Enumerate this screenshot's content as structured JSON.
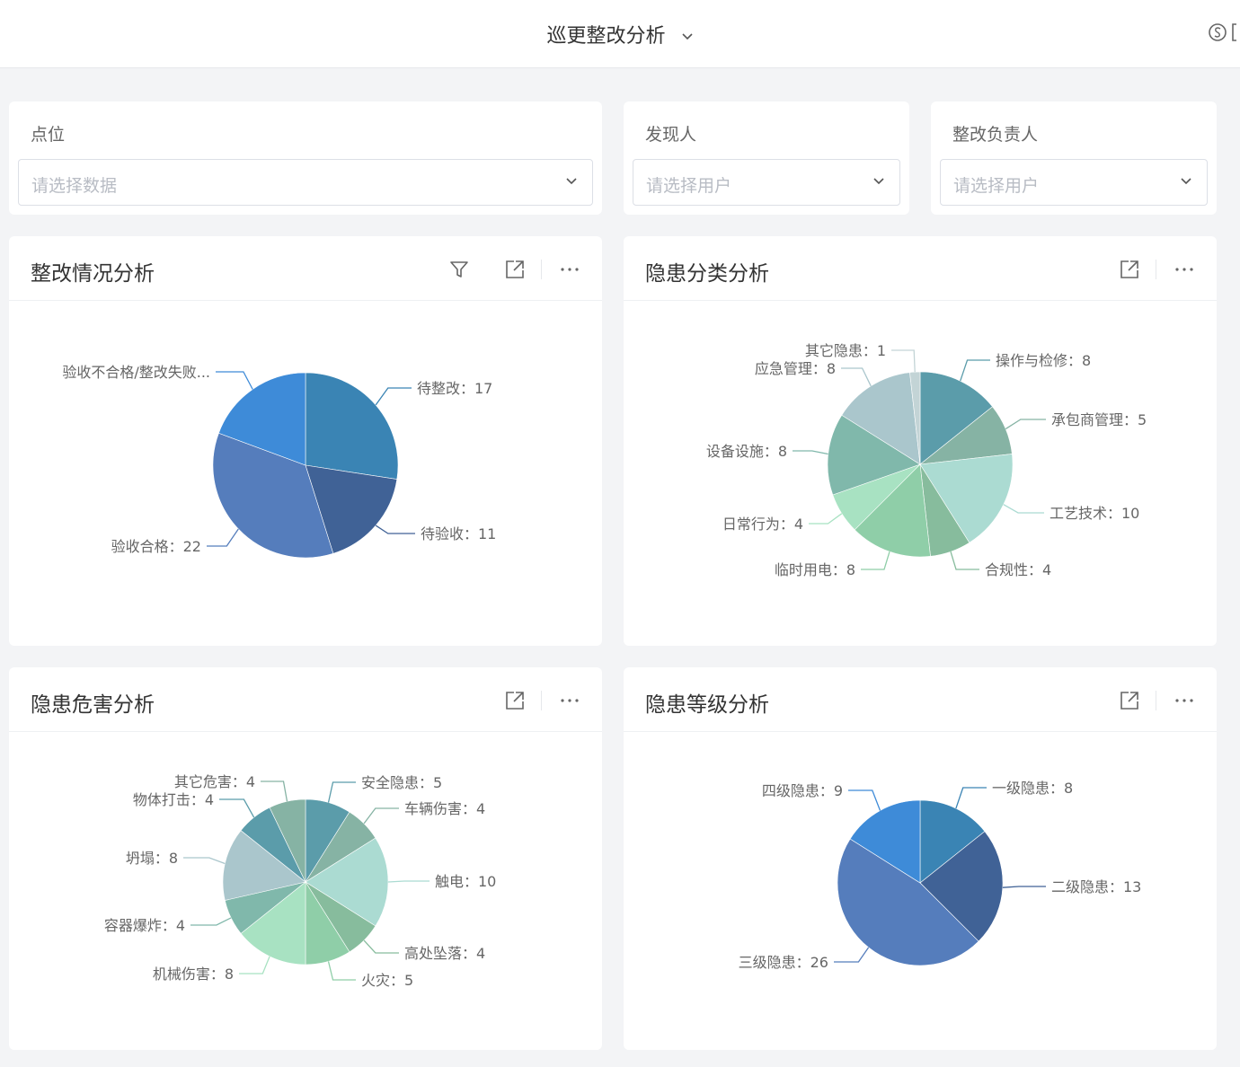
{
  "header": {
    "title": "巡更整改分析"
  },
  "filters": [
    {
      "label": "点位",
      "placeholder": "请选择数据"
    },
    {
      "label": "发现人",
      "placeholder": "请选择用户"
    },
    {
      "label": "整改负责人",
      "placeholder": "请选择用户"
    }
  ],
  "panels": [
    {
      "title": "整改情况分析"
    },
    {
      "title": "隐患分类分析"
    },
    {
      "title": "隐患危害分析"
    },
    {
      "title": "隐患等级分析"
    }
  ],
  "chart_data": [
    {
      "type": "pie",
      "title": "整改情况分析",
      "slices": [
        {
          "name": "待整改",
          "label": "待整改：17",
          "value": 17,
          "color": "#3a84b4"
        },
        {
          "name": "待验收",
          "label": "待验收：11",
          "value": 11,
          "color": "#406296"
        },
        {
          "name": "验收合格",
          "label": "验收合格：22",
          "value": 22,
          "color": "#557dbc"
        },
        {
          "name": "验收不合格/整改失败",
          "label": "验收不合格/整改失败...",
          "value": 12,
          "color": "#3e8bd8"
        }
      ]
    },
    {
      "type": "pie",
      "title": "隐患分类分析",
      "slices": [
        {
          "name": "操作与检修",
          "label": "操作与检修：8",
          "value": 8,
          "color": "#5b9caa"
        },
        {
          "name": "承包商管理",
          "label": "承包商管理：5",
          "value": 5,
          "color": "#86b3a4"
        },
        {
          "name": "工艺技术",
          "label": "工艺技术：10",
          "value": 10,
          "color": "#abdbd2"
        },
        {
          "name": "合规性",
          "label": "合规性：4",
          "value": 4,
          "color": "#87bc9d"
        },
        {
          "name": "临时用电",
          "label": "临时用电：8",
          "value": 8,
          "color": "#8fcea8"
        },
        {
          "name": "日常行为",
          "label": "日常行为：4",
          "value": 4,
          "color": "#a8e2c2"
        },
        {
          "name": "设备设施",
          "label": "设备设施：8",
          "value": 8,
          "color": "#80b8ab"
        },
        {
          "name": "应急管理",
          "label": "应急管理：8",
          "value": 8,
          "color": "#aac6cc"
        },
        {
          "name": "其它隐患",
          "label": "其它隐患：1",
          "value": 1,
          "color": "#c3d4d6"
        }
      ]
    },
    {
      "type": "pie",
      "title": "隐患危害分析",
      "slices": [
        {
          "name": "安全隐患",
          "label": "安全隐患：5",
          "value": 5,
          "color": "#5b9caa"
        },
        {
          "name": "车辆伤害",
          "label": "车辆伤害：4",
          "value": 4,
          "color": "#86b3a4"
        },
        {
          "name": "触电",
          "label": "触电：10",
          "value": 10,
          "color": "#abdbd2"
        },
        {
          "name": "高处坠落",
          "label": "高处坠落：4",
          "value": 4,
          "color": "#87bc9d"
        },
        {
          "name": "火灾",
          "label": "火灾：5",
          "value": 5,
          "color": "#8fcea8"
        },
        {
          "name": "机械伤害",
          "label": "机械伤害：8",
          "value": 8,
          "color": "#a8e2c2"
        },
        {
          "name": "容器爆炸",
          "label": "容器爆炸：4",
          "value": 4,
          "color": "#80b8ab"
        },
        {
          "name": "坍塌",
          "label": "坍塌：8",
          "value": 8,
          "color": "#aac6cc"
        },
        {
          "name": "物体打击",
          "label": "物体打击：4",
          "value": 4,
          "color": "#5b9caa"
        },
        {
          "name": "其它危害",
          "label": "其它危害：4",
          "value": 4,
          "color": "#86b3a4"
        }
      ]
    },
    {
      "type": "pie",
      "title": "隐患等级分析",
      "slices": [
        {
          "name": "一级隐患",
          "label": "一级隐患：8",
          "value": 8,
          "color": "#3a84b4"
        },
        {
          "name": "二级隐患",
          "label": "二级隐患：13",
          "value": 13,
          "color": "#406296"
        },
        {
          "name": "三级隐患",
          "label": "三级隐患：26",
          "value": 26,
          "color": "#557dbc"
        },
        {
          "name": "四级隐患",
          "label": "四级隐患：9",
          "value": 9,
          "color": "#3e8bd8"
        }
      ]
    }
  ]
}
